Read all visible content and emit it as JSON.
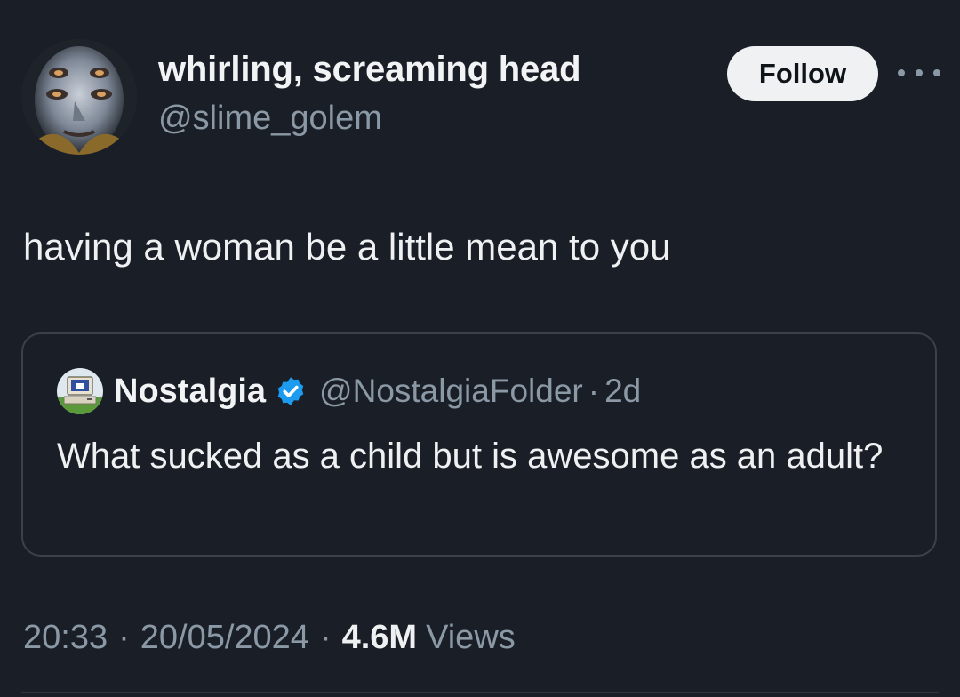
{
  "author": {
    "display_name": "whirling, screaming head",
    "handle": "@slime_golem",
    "avatar_icon": "face-portrait-avatar"
  },
  "actions": {
    "follow_label": "Follow",
    "more_icon": "more-horizontal-icon"
  },
  "tweet": {
    "text": "having a woman be a little mean to you"
  },
  "quote": {
    "display_name": "Nostalgia",
    "verified": true,
    "verified_color": "#1d9bf0",
    "handle": "@NostalgiaFolder",
    "separator": "·",
    "time": "2d",
    "text": "What sucked as a child but is awesome as an adult?",
    "avatar_icon": "retro-computer-avatar"
  },
  "meta": {
    "time": "20:33",
    "separator": "·",
    "date": "20/05/2024",
    "views_count": "4.6M",
    "views_label": "Views"
  },
  "colors": {
    "background": "#1a1f27",
    "text_primary": "#e7e9ea",
    "text_secondary": "#8b98a5",
    "border": "#3a414b",
    "follow_bg": "#eff1f2"
  }
}
